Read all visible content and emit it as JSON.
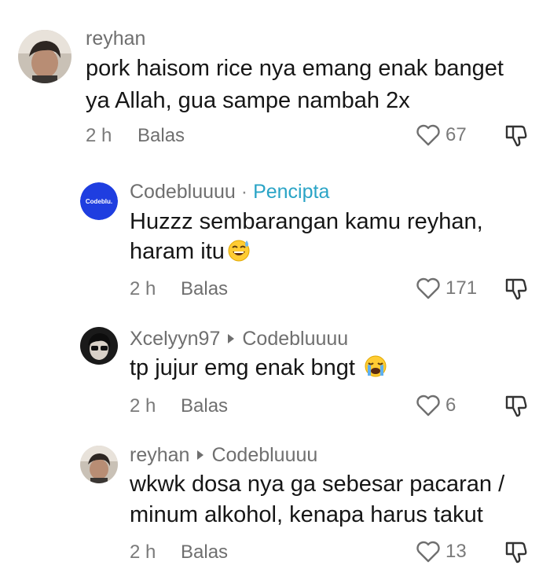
{
  "comments": [
    {
      "username": "reyhan",
      "text_line1": "pork haisom rice nya emang enak banget",
      "text_line2": "ya Allah, gua sampe nambah 2x",
      "time": "2 h",
      "reply_label": "Balas",
      "likes": "67"
    },
    {
      "username": "Codebluuuu",
      "separator": "·",
      "badge": "Pencipta",
      "avatar_text": "Codeblu.",
      "text_line1": "Huzzz sembarangan kamu reyhan,",
      "text_line2": "haram itu",
      "emoji": "sweat-smile-emoji",
      "time": "2 h",
      "reply_label": "Balas",
      "likes": "171"
    },
    {
      "username": "Xcelyyn97",
      "reply_to": "Codebluuuu",
      "text_line1": "tp jujur emg enak bngt",
      "emoji": "loudly-crying-emoji",
      "time": "2 h",
      "reply_label": "Balas",
      "likes": "6"
    },
    {
      "username": "reyhan",
      "reply_to": "Codebluuuu",
      "text_line1": "wkwk dosa nya ga sebesar pacaran /",
      "text_line2": "minum alkohol, kenapa harus takut",
      "time": "2 h",
      "reply_label": "Balas",
      "likes": "13"
    }
  ],
  "colors": {
    "username": "#6f6f6f",
    "creator_badge": "#2aa4c6",
    "text": "#161616",
    "meta": "#7a7a7a",
    "codeblu_avatar": "#1f3ee0"
  }
}
